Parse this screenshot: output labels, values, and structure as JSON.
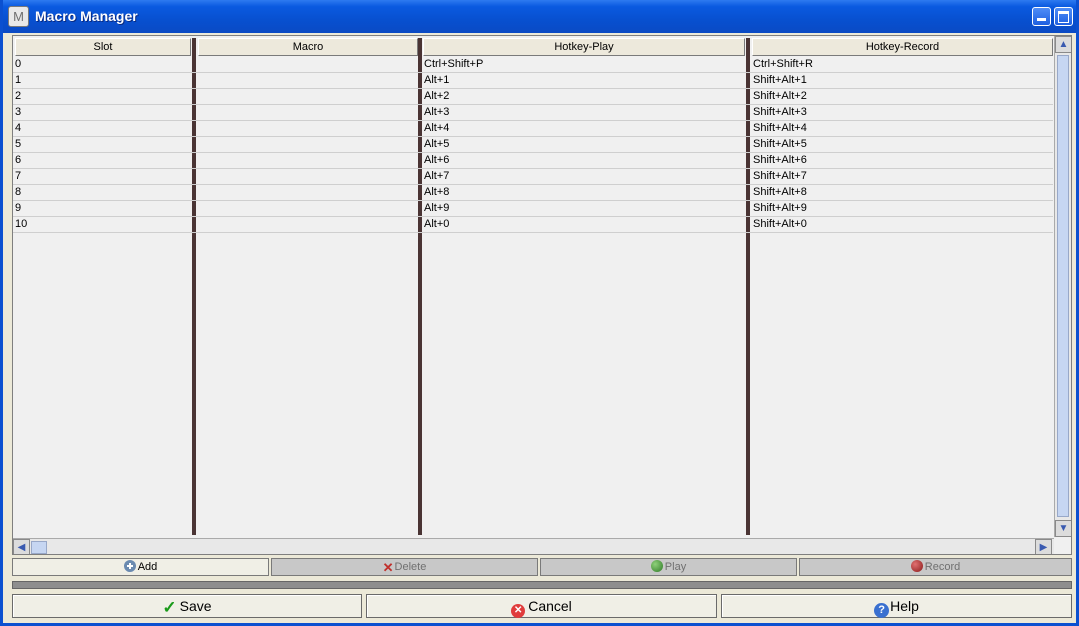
{
  "window": {
    "title": "Macro Manager",
    "icon_letter": "M"
  },
  "table": {
    "columns": [
      "Slot",
      "Macro",
      "Hotkey-Play",
      "Hotkey-Record"
    ],
    "rows": [
      [
        "0",
        "",
        "Ctrl+Shift+P",
        "Ctrl+Shift+R"
      ],
      [
        "1",
        "",
        "Alt+1",
        "Shift+Alt+1"
      ],
      [
        "2",
        "",
        "Alt+2",
        "Shift+Alt+2"
      ],
      [
        "3",
        "",
        "Alt+3",
        "Shift+Alt+3"
      ],
      [
        "4",
        "",
        "Alt+4",
        "Shift+Alt+4"
      ],
      [
        "5",
        "",
        "Alt+5",
        "Shift+Alt+5"
      ],
      [
        "6",
        "",
        "Alt+6",
        "Shift+Alt+6"
      ],
      [
        "7",
        "",
        "Alt+7",
        "Shift+Alt+7"
      ],
      [
        "8",
        "",
        "Alt+8",
        "Shift+Alt+8"
      ],
      [
        "9",
        "",
        "Alt+9",
        "Shift+Alt+9"
      ],
      [
        "10",
        "",
        "Alt+0",
        "Shift+Alt+0"
      ]
    ]
  },
  "actions": {
    "add": "Add",
    "delete": "Delete",
    "play": "Play",
    "record": "Record"
  },
  "progress": {
    "value": 0
  },
  "footer": {
    "save": "Save",
    "cancel": "Cancel",
    "help": "Help"
  },
  "colors": {
    "title_bar": "#0850d0",
    "column_separator": "#4a3434",
    "add_icon": "#6a8ab0",
    "delete_icon": "#c0302c",
    "play_icon": "#3a8a30",
    "record_icon": "#a02020",
    "save_icon": "#1a9a1a",
    "cancel_icon": "#e03c3c",
    "help_icon": "#3a70d0"
  },
  "icons": {
    "add": "plus-circle-icon",
    "delete": "x-icon",
    "play": "green-circle-icon",
    "record": "red-circle-icon",
    "save": "checkmark-icon",
    "cancel": "cancel-icon",
    "help": "help-icon"
  }
}
